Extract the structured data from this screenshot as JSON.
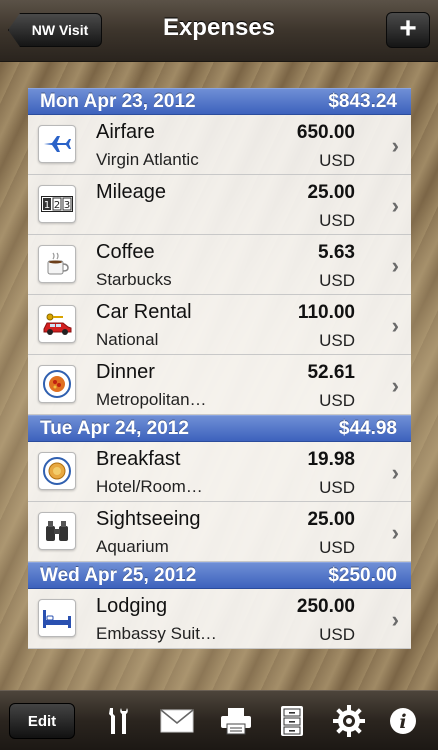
{
  "navbar": {
    "back_label": "NW Visit",
    "title": "Expenses",
    "add_label": "+"
  },
  "sections": [
    {
      "date": "Mon Apr 23, 2012",
      "total": "$843.24",
      "items": [
        {
          "name": "Airfare",
          "sub": "Virgin Atlantic",
          "amount": "650.00",
          "currency": "USD",
          "icon": "airplane-icon"
        },
        {
          "name": "Mileage",
          "sub": "",
          "amount": "25.00",
          "currency": "USD",
          "icon": "odometer-icon"
        },
        {
          "name": "Coffee",
          "sub": "Starbucks",
          "amount": "5.63",
          "currency": "USD",
          "icon": "coffee-cup-icon"
        },
        {
          "name": "Car Rental",
          "sub": "National",
          "amount": "110.00",
          "currency": "USD",
          "icon": "car-key-icon"
        },
        {
          "name": "Dinner",
          "sub": "Metropolitan…",
          "amount": "52.61",
          "currency": "USD",
          "icon": "dinner-plate-icon"
        }
      ]
    },
    {
      "date": "Tue Apr 24, 2012",
      "total": "$44.98",
      "items": [
        {
          "name": "Breakfast",
          "sub": "Hotel/Room…",
          "amount": "19.98",
          "currency": "USD",
          "icon": "breakfast-plate-icon"
        },
        {
          "name": "Sightseeing",
          "sub": "Aquarium",
          "amount": "25.00",
          "currency": "USD",
          "icon": "binoculars-icon"
        }
      ]
    },
    {
      "date": "Wed Apr 25, 2012",
      "total": "$250.00",
      "items": [
        {
          "name": "Lodging",
          "sub": "Embassy Suit…",
          "amount": "250.00",
          "currency": "USD",
          "icon": "bed-icon"
        }
      ]
    }
  ],
  "toolbar": {
    "edit_label": "Edit",
    "icons": [
      "tools-icon",
      "mail-icon",
      "printer-icon",
      "file-cabinet-icon",
      "gear-icon",
      "info-icon"
    ]
  },
  "row_chevron": "›"
}
